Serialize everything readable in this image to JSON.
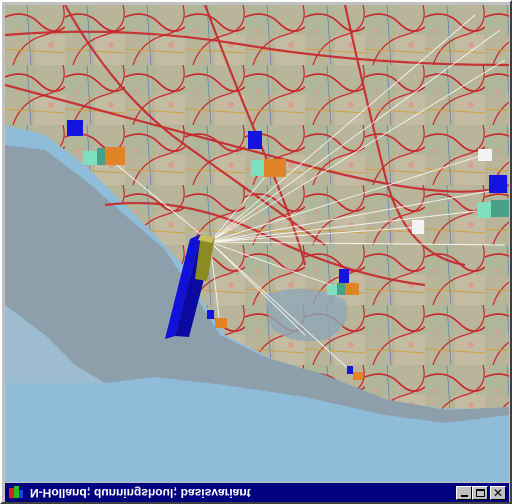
{
  "window": {
    "title": "N-Holland; dunningshoul; basisvariant",
    "buttons": {
      "minimize_icon": "minimize-icon",
      "maximize_icon": "maximize-icon",
      "close_icon": "close-icon"
    }
  },
  "colors": {
    "titlebar": "#000080",
    "sky": "#8fbcd8",
    "sea": "#8c9fab",
    "map_base": "#b7b49a",
    "road": "#c8262a",
    "tall_bar": "#1010d8",
    "tall_bar_side": "#8c8a22",
    "marker_teal": "#7fe0c0",
    "marker_orange": "#e08428",
    "marker_blue": "#1414e0",
    "link_line": "#ffffff"
  },
  "icons": {
    "app_icon": "app-logo-icon"
  }
}
